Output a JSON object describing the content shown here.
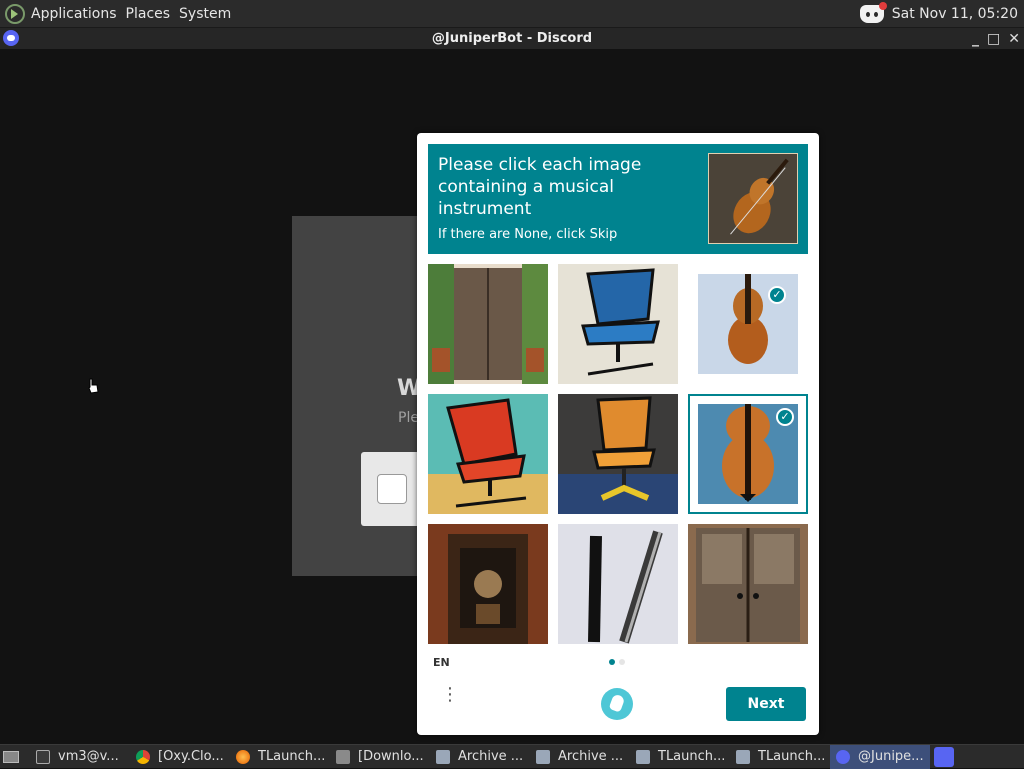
{
  "top_panel": {
    "menus": [
      "Applications",
      "Places",
      "System"
    ],
    "clock": "Sat Nov 11, 05:20"
  },
  "window": {
    "title": "@JuniperBot - Discord",
    "controls": [
      "_",
      "□",
      "✕"
    ]
  },
  "background_dialog": {
    "heading_fragment": "W",
    "subtitle_fragment": "Ple"
  },
  "captcha": {
    "prompt": "Please click each image containing a musical instrument",
    "hint": "If there are None, click Skip",
    "example_icon": "violin-image",
    "tiles": [
      {
        "subject": "wooden-door-plants",
        "selected": false
      },
      {
        "subject": "blue-office-chair",
        "selected": false
      },
      {
        "subject": "violin",
        "selected": true
      },
      {
        "subject": "red-office-chair",
        "selected": false
      },
      {
        "subject": "orange-chair",
        "selected": false
      },
      {
        "subject": "violin-closeup",
        "selected": true
      },
      {
        "subject": "ornate-door",
        "selected": false
      },
      {
        "subject": "pen",
        "selected": false
      },
      {
        "subject": "old-wooden-door",
        "selected": false
      }
    ],
    "language": "EN",
    "page_indicator": {
      "current": 1,
      "total": 2
    },
    "next_label": "Next",
    "accent_color": "#00838f"
  },
  "taskbar": {
    "items": [
      {
        "label": "vm3@v...",
        "icon": "terminal-icon",
        "active": false
      },
      {
        "label": "[Oxy.Clo...",
        "icon": "chrome-icon",
        "active": false
      },
      {
        "label": "TLaunch...",
        "icon": "firefox-icon",
        "active": false
      },
      {
        "label": "[Downlo...",
        "icon": "folder-icon",
        "active": false
      },
      {
        "label": "Archive ...",
        "icon": "archive-icon",
        "active": false
      },
      {
        "label": "Archive ...",
        "icon": "archive-icon",
        "active": false
      },
      {
        "label": "TLaunch...",
        "icon": "archive-icon",
        "active": false
      },
      {
        "label": "TLaunch...",
        "icon": "archive-icon",
        "active": false
      },
      {
        "label": "@Junipe...",
        "icon": "discord-icon",
        "active": true
      }
    ]
  }
}
